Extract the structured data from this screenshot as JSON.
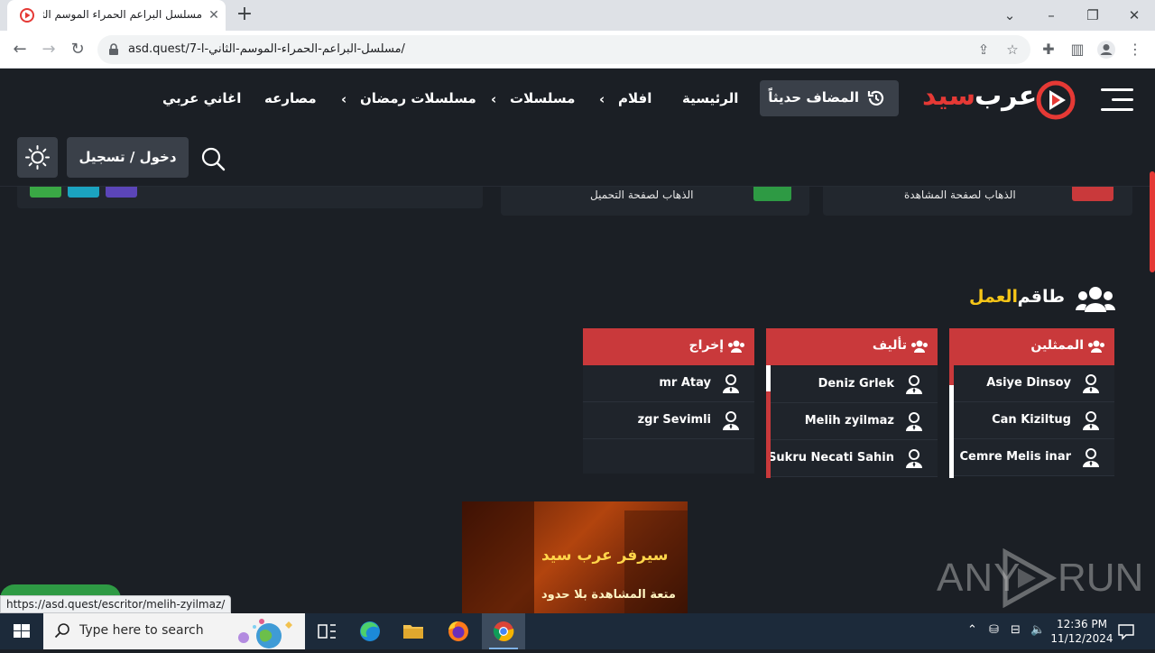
{
  "browser": {
    "tab_title": "مسلسل البراعم الحمراء الموسم الثا",
    "url": "asd.quest/7-مسلسل-البراعم-الحمراء-الموسم-الثاني-ا/",
    "status_url": "https://asd.quest/escritor/melih-zyilmaz/"
  },
  "header": {
    "logo_part_a": "عرب",
    "logo_part_b": "سيد",
    "recent_label": "المضاف حديثاً",
    "nav": {
      "home": "الرئيسية",
      "movies": "افلام",
      "series": "مسلسلات",
      "ramadan": "مسلسلات رمضان",
      "wrestling": "مصارعه",
      "songs": "اغاني عربي"
    },
    "login_label": "دخول / تسجيل"
  },
  "panels": {
    "watch_link": "الذهاب لصفحة المشاهدة",
    "download_link": "الذهاب لصفحة التحميل"
  },
  "crew": {
    "title_main": "طاقم",
    "title_accent": "العمل",
    "columns": {
      "cast": {
        "title": "الممثلين",
        "people": [
          "Asiye Dinsoy",
          "Can Kiziltug",
          "Cemre Melis inar"
        ]
      },
      "writing": {
        "title": "تأليف",
        "people": [
          "Deniz Grlek",
          "Melih zyilmaz",
          "Sukru Necati Sahin"
        ]
      },
      "directing": {
        "title": "إخراج",
        "people": [
          "mr Atay",
          "zgr Sevimli"
        ]
      }
    }
  },
  "poster": {
    "line1": "سيرفر عرب سيد",
    "line2": "متعة المشاهدة بلا حدود"
  },
  "watermark": {
    "left": "ANY",
    "right": "RUN"
  },
  "taskbar": {
    "search_placeholder": "Type here to search",
    "time": "12:36 PM",
    "date": "11/12/2024"
  },
  "colors": {
    "accent_red": "#c9393b",
    "accent_yellow": "#f5c518",
    "bg_dark": "#1b1f25",
    "chip_green": "#3aa845",
    "chip_teal": "#1ba3c0",
    "chip_purple": "#5b45b8"
  },
  "icons": [
    "history-icon",
    "search-icon",
    "sun-icon",
    "menu-icon",
    "users-icon",
    "user-tie-icon",
    "chevron-left-icon"
  ]
}
